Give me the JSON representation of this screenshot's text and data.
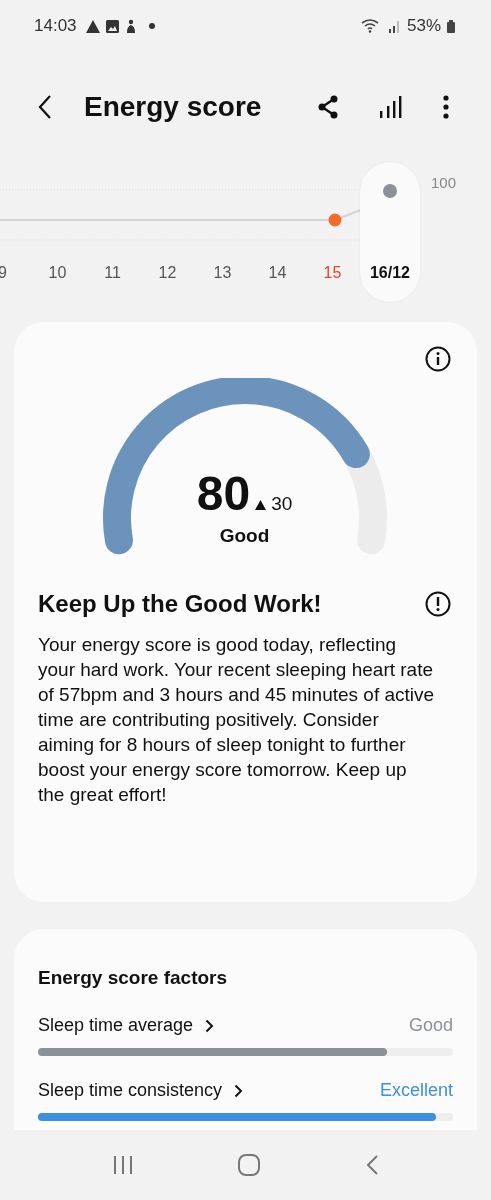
{
  "status_bar": {
    "time": "14:03",
    "battery": "53%"
  },
  "header": {
    "title": "Energy score"
  },
  "trend": {
    "max_label": "100",
    "days": [
      {
        "label": "9",
        "selected": false,
        "color": "#555555"
      },
      {
        "label": "10",
        "selected": false,
        "color": "#555555"
      },
      {
        "label": "11",
        "selected": false,
        "color": "#555555"
      },
      {
        "label": "12",
        "selected": false,
        "color": "#555555"
      },
      {
        "label": "13",
        "selected": false,
        "color": "#555555"
      },
      {
        "label": "14",
        "selected": false,
        "color": "#555555"
      },
      {
        "label": "15",
        "selected": false,
        "color": "#e0452b"
      },
      {
        "label": "16/12",
        "selected": true,
        "color": "#111111"
      }
    ]
  },
  "score": {
    "value": "80",
    "change": "30",
    "rating": "Good"
  },
  "message": {
    "title": "Keep Up the Good Work!",
    "body": "Your energy score is good today, reflecting your hard work. Your recent sleeping heart rate of 57bpm and 3 hours and 45 minutes of active time are contributing positively. Consider aiming for 8 hours of sleep tonight to further boost your energy score tomorrow. Keep up the great effort!"
  },
  "factors": {
    "title": "Energy score factors",
    "items": [
      {
        "name": "Sleep time average",
        "rating": "Good",
        "color": "#8a9198",
        "level": 0.84
      },
      {
        "name": "Sleep time consistency",
        "rating": "Excellent",
        "color": "#3d8fe0",
        "level": 0.96
      }
    ]
  }
}
